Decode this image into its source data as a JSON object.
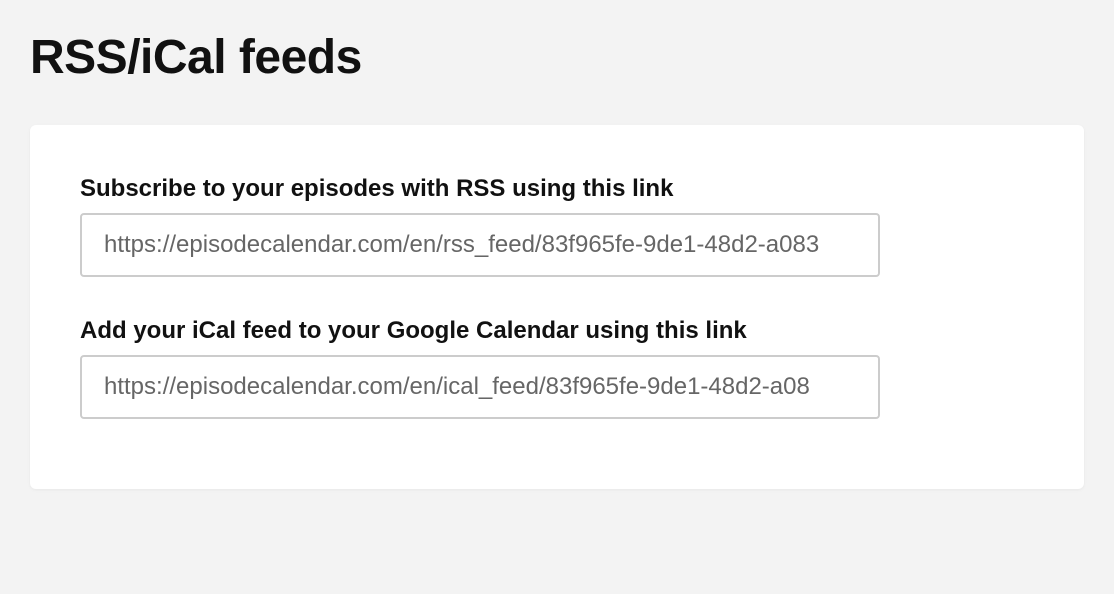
{
  "page": {
    "title": "RSS/iCal feeds"
  },
  "feeds": {
    "rss": {
      "label": "Subscribe to your episodes with RSS using this link",
      "url": "https://episodecalendar.com/en/rss_feed/83f965fe-9de1-48d2-a083"
    },
    "ical": {
      "label": "Add your iCal feed to your Google Calendar using this link",
      "url": "https://episodecalendar.com/en/ical_feed/83f965fe-9de1-48d2-a08"
    }
  }
}
